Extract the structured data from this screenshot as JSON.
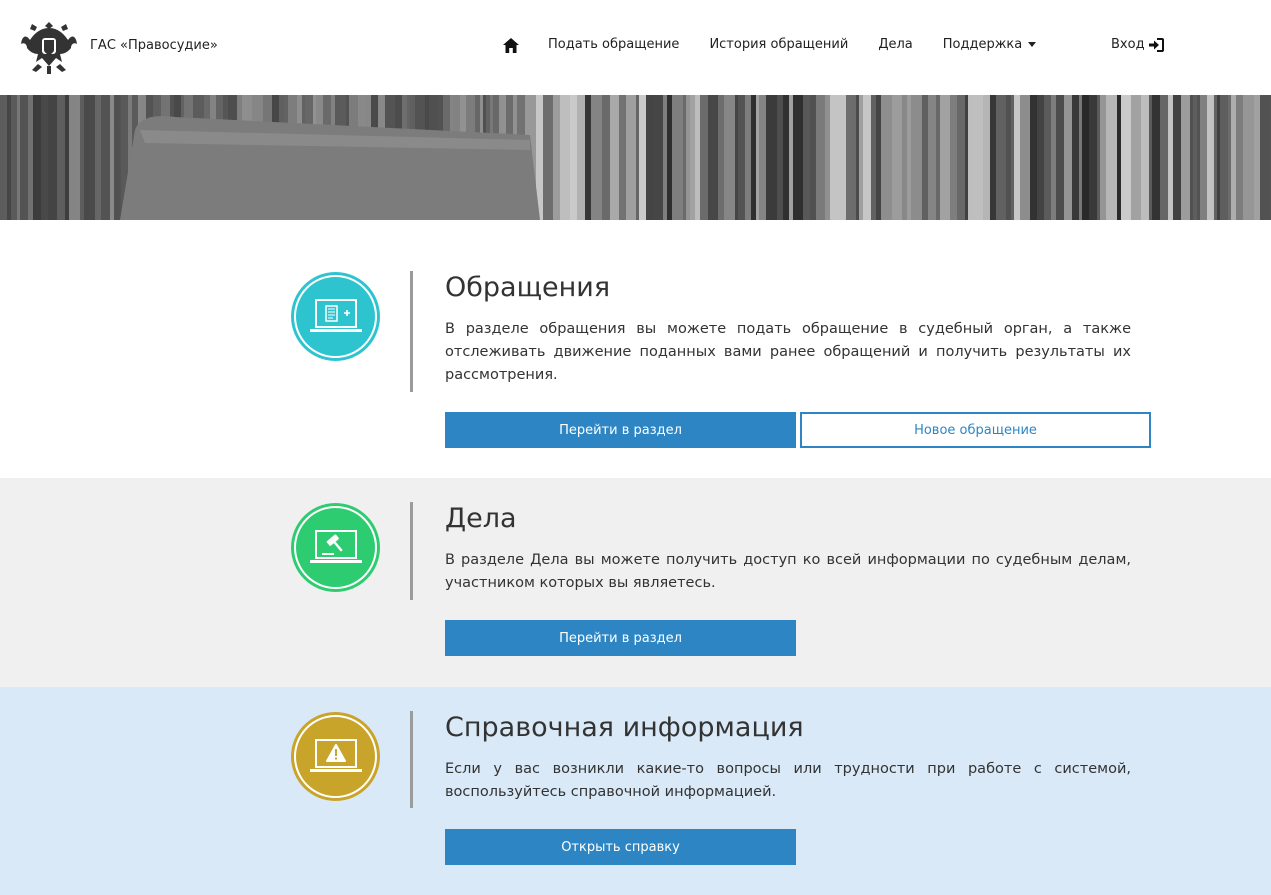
{
  "header": {
    "brand_name": "ГАС «Правосудие»",
    "nav": [
      {
        "label": "Подать обращение"
      },
      {
        "label": "История обращений"
      },
      {
        "label": "Дела"
      },
      {
        "label": "Поддержка"
      }
    ],
    "login_label": "Вход"
  },
  "sections": [
    {
      "title": "Обращения",
      "description": "В разделе обращения вы можете подать обращение в судебный орган, а также отслеживать движение поданных вами ранее обращений и получить результаты их рассмотрения.",
      "primary_button": "Перейти в раздел",
      "secondary_button": "Новое обращение",
      "icon": "document-plus-icon",
      "color": "#2ec4cf"
    },
    {
      "title": "Дела",
      "description": "В разделе Дела вы можете получить доступ ко всей информации по судебным делам, участником которых вы являетесь.",
      "primary_button": "Перейти в раздел",
      "icon": "gavel-icon",
      "color": "#2ecc71"
    },
    {
      "title": "Справочная информация",
      "description": "Если у вас возникли какие-то вопросы или трудности при работе с системой, воспользуйтесь справочной информацией.",
      "primary_button": "Открыть справку",
      "icon": "warning-icon",
      "color": "#c9a42a"
    }
  ],
  "colors": {
    "accent": "#2d86c3",
    "section2_bg": "#f0f0f0",
    "section3_bg": "#d9e9f7"
  }
}
